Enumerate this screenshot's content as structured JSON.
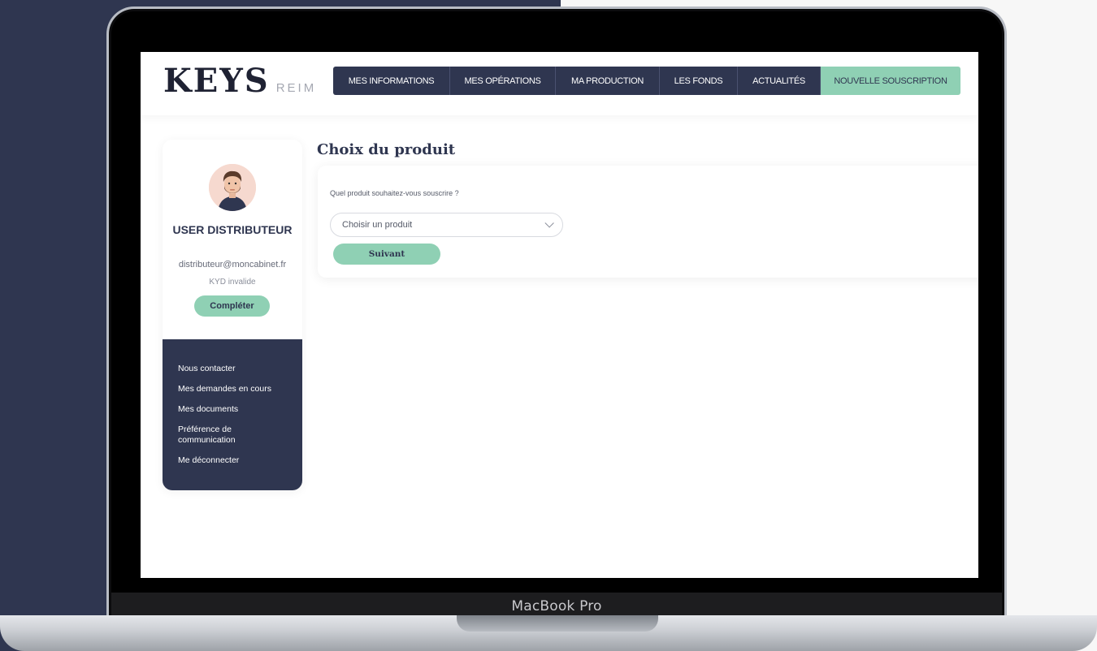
{
  "device": {
    "label": "MacBook Pro"
  },
  "header": {
    "logo_main": "KEYS",
    "logo_sub": "REIM",
    "nav": [
      {
        "label": "MES INFORMATIONS"
      },
      {
        "label": "MES OPÉRATIONS"
      },
      {
        "label": "MA PRODUCTION"
      },
      {
        "label": "LES FONDS"
      },
      {
        "label": "ACTUALITÉS"
      },
      {
        "label": "NOUVELLE SOUSCRIPTION"
      }
    ]
  },
  "sidebar": {
    "avatar_icon": "user-avatar-icon",
    "user_name": "USER DISTRIBUTEUR",
    "email": "distributeur@moncabinet.fr",
    "kyd_status": "KYD invalide",
    "complete_label": "Compléter",
    "menu": [
      {
        "label": "Nous contacter"
      },
      {
        "label": "Mes demandes en cours"
      },
      {
        "label": "Mes documents"
      },
      {
        "label": "Préférence de communication"
      },
      {
        "label": "Me déconnecter"
      }
    ]
  },
  "main": {
    "title": "Choix du produit",
    "question": "Quel produit souhaitez-vous souscrire ?",
    "select_value": "Choisir un produit",
    "next_label": "Suivant"
  },
  "colors": {
    "navy": "#2f3650",
    "mint": "#8fd0b4",
    "background": "#f7f7f7"
  }
}
